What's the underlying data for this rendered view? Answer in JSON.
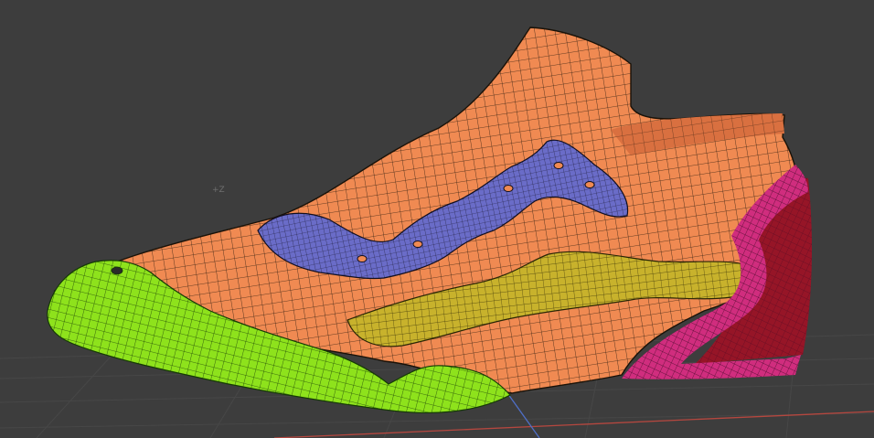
{
  "viewport": {
    "axis_label": "+Z",
    "colors": {
      "background": "#3d3d3d",
      "grid_line": "#474747",
      "x_axis": "#b5473f",
      "y_axis": "#4f6fc7",
      "wire": "#1a1208"
    }
  },
  "model": {
    "object": "shoe",
    "display": "wireframe-on-shaded",
    "parts": [
      {
        "name": "upper-body",
        "color": "#f08a52"
      },
      {
        "name": "collar-inner",
        "color": "#e8804a"
      },
      {
        "name": "lace-panel",
        "color": "#6a6cc8"
      },
      {
        "name": "side-stripe",
        "color": "#c8b22c"
      },
      {
        "name": "toe-cap-and-sole",
        "color": "#8ee21c"
      },
      {
        "name": "heel-counter",
        "color": "#d02d7e"
      },
      {
        "name": "heel-inner",
        "color": "#961527"
      }
    ]
  }
}
